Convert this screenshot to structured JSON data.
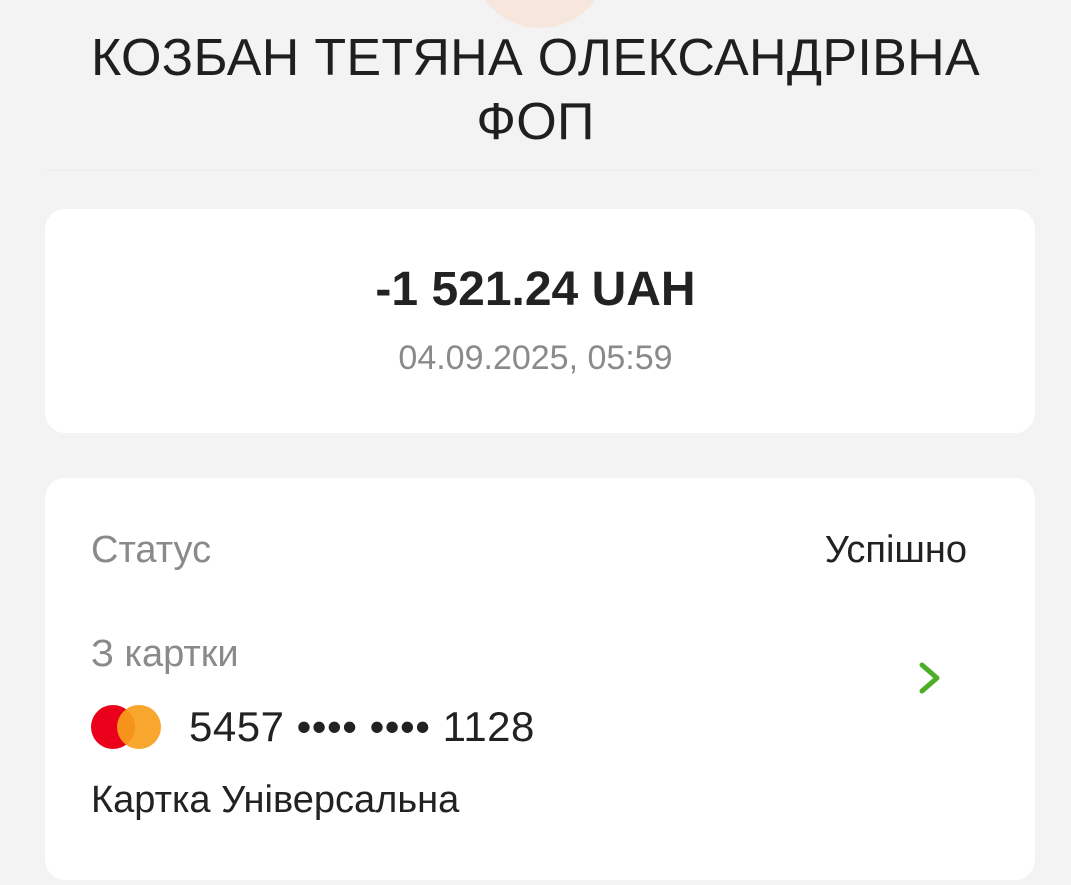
{
  "merchant": {
    "title_line1": "КОЗБАН ТЕТЯНА ОЛЕКСАНДРІВНА",
    "title_line2": "ФОП"
  },
  "transaction": {
    "amount": "-1 521.24 UAH",
    "datetime": "04.09.2025, 05:59"
  },
  "details": {
    "status_label": "Статус",
    "status_value": "Успішно",
    "from_card_label": "З картки",
    "card_number": "5457 •••• •••• 1128",
    "card_name": "Картка Універсальна",
    "card_brand_icon": "mastercard-icon",
    "chevron_icon": "chevron-right-icon"
  },
  "colors": {
    "background": "#f3f3f3",
    "card_background": "#ffffff",
    "accent_green": "#4caf27",
    "secondary_text": "#8a8a8a",
    "primary_text": "#222222",
    "avatar_tint": "#f6e6dc"
  }
}
